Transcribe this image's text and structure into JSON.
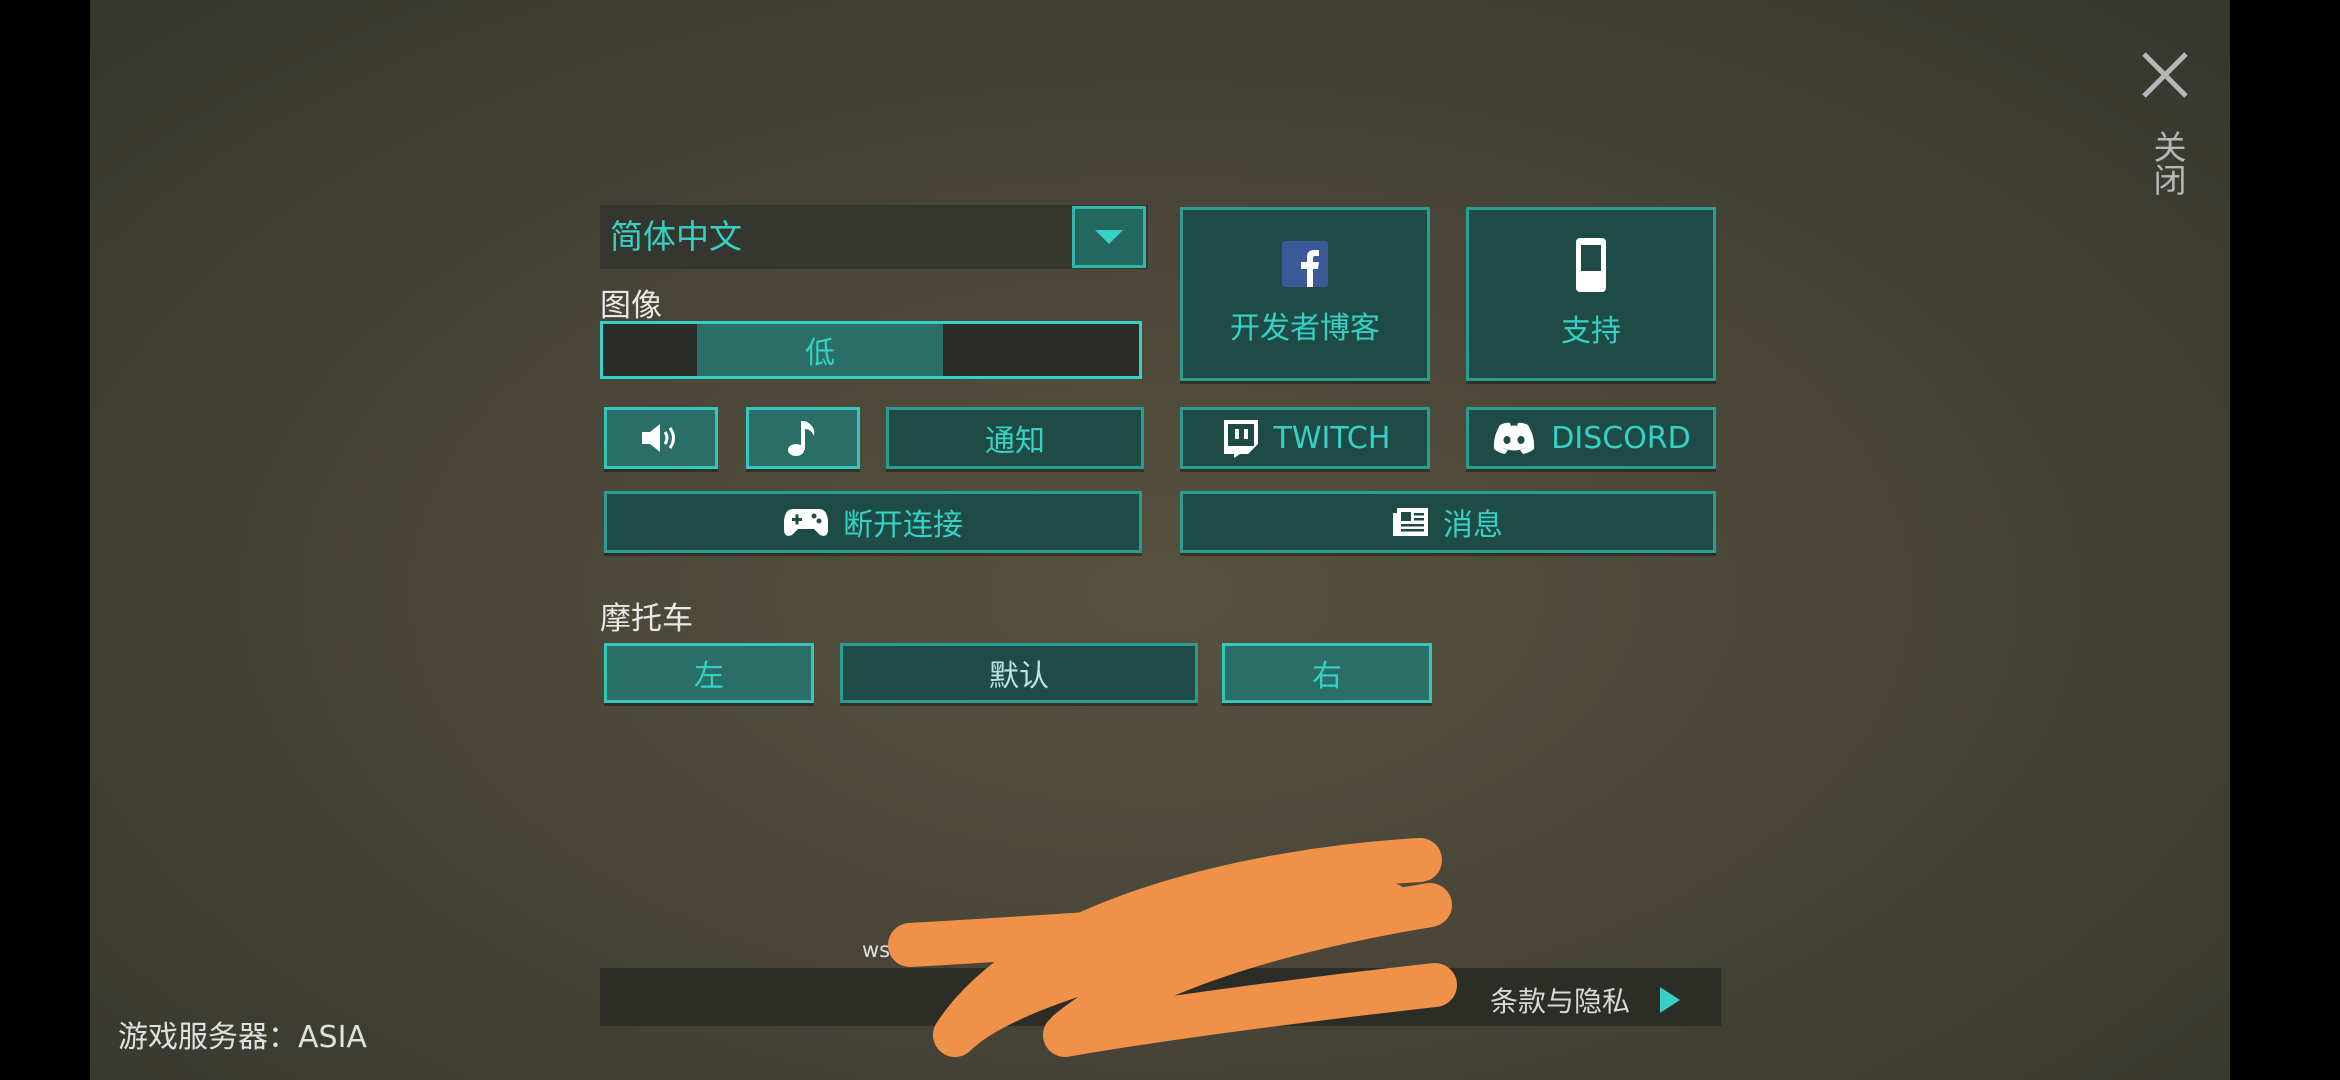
{
  "language": {
    "selected": "简体中文"
  },
  "graphics": {
    "label": "图像",
    "value": "低"
  },
  "buttons": {
    "notify": "通知",
    "disconnect": "断开连接",
    "dev_blog": "开发者博客",
    "support": "支持",
    "twitch": "TWITCH",
    "discord": "DISCORD",
    "news": "消息"
  },
  "motorcycle": {
    "label": "摩托车",
    "left": "左",
    "default": "默认",
    "right": "右"
  },
  "close_label": "关闭",
  "server": {
    "text": "游戏服务器：ASIA"
  },
  "footer": {
    "terms": "条款与隐私",
    "ws_text": "ws"
  },
  "icons": [
    "volume-icon",
    "music-note-icon",
    "facebook-icon",
    "support-device-icon",
    "twitch-icon",
    "discord-icon",
    "gamepad-icon",
    "newspaper-icon",
    "close-icon",
    "chevron-down-icon",
    "play-arrow-icon"
  ],
  "colors": {
    "accent": "#36d1c4",
    "button_bg": "#1f4b47",
    "button_active": "#2a6e67",
    "scribble": "#f0914a"
  }
}
